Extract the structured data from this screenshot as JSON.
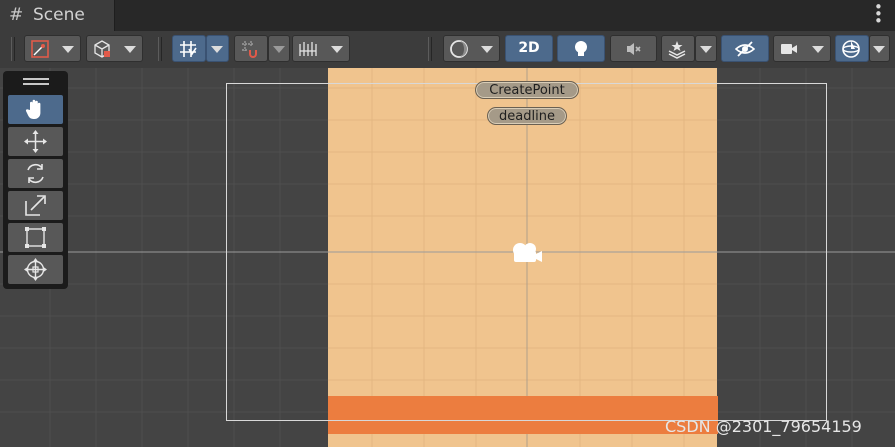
{
  "tab": {
    "icon": "grid-hash-icon",
    "label": "Scene"
  },
  "window_menu_icon": "vertical-ellipsis-icon",
  "toolbar": {
    "draw_mode_icon": "shaded-draw-mode-icon",
    "view_options_icon": "wireframe-cube-icon",
    "grid_snap_icon": "grid-snap-icon",
    "increment_snap_icon": "increment-snap-icon",
    "grid_visibility_icon": "grid-ruler-icon",
    "shading_sphere_icon": "shading-sphere-icon",
    "mode_2d_label": "2D",
    "lighting_icon": "lightbulb-icon",
    "audio_icon": "speaker-muted-icon",
    "effects_icon": "effects-layers-icon",
    "hidden_objects_icon": "eye-crossed-icon",
    "camera_icon": "video-camera-icon",
    "gizmos_icon": "gizmo-sphere-icon"
  },
  "tool_palette": {
    "items": [
      {
        "name": "hand-tool",
        "icon": "hand-icon",
        "active": true
      },
      {
        "name": "move-tool",
        "icon": "move-arrows-icon",
        "active": false
      },
      {
        "name": "rotate-tool",
        "icon": "rotate-arrows-icon",
        "active": false
      },
      {
        "name": "scale-tool",
        "icon": "scale-arrow-icon",
        "active": false
      },
      {
        "name": "rect-tool",
        "icon": "rect-transform-icon",
        "active": false
      },
      {
        "name": "transform-tool",
        "icon": "transform-gizmo-icon",
        "active": false
      }
    ]
  },
  "scene": {
    "buttons": [
      {
        "label": "CreatePoint"
      },
      {
        "label": "deadline"
      }
    ],
    "main_camera_icon": "camera-gizmo-icon",
    "background_color": "#f0c48e",
    "platform_color": "#ec7d3f"
  },
  "watermark": "CSDN @2301_79654159",
  "colors": {
    "active_button": "#4d6a8c",
    "toolbar": "#3c3c3c",
    "viewport": "#444444"
  }
}
